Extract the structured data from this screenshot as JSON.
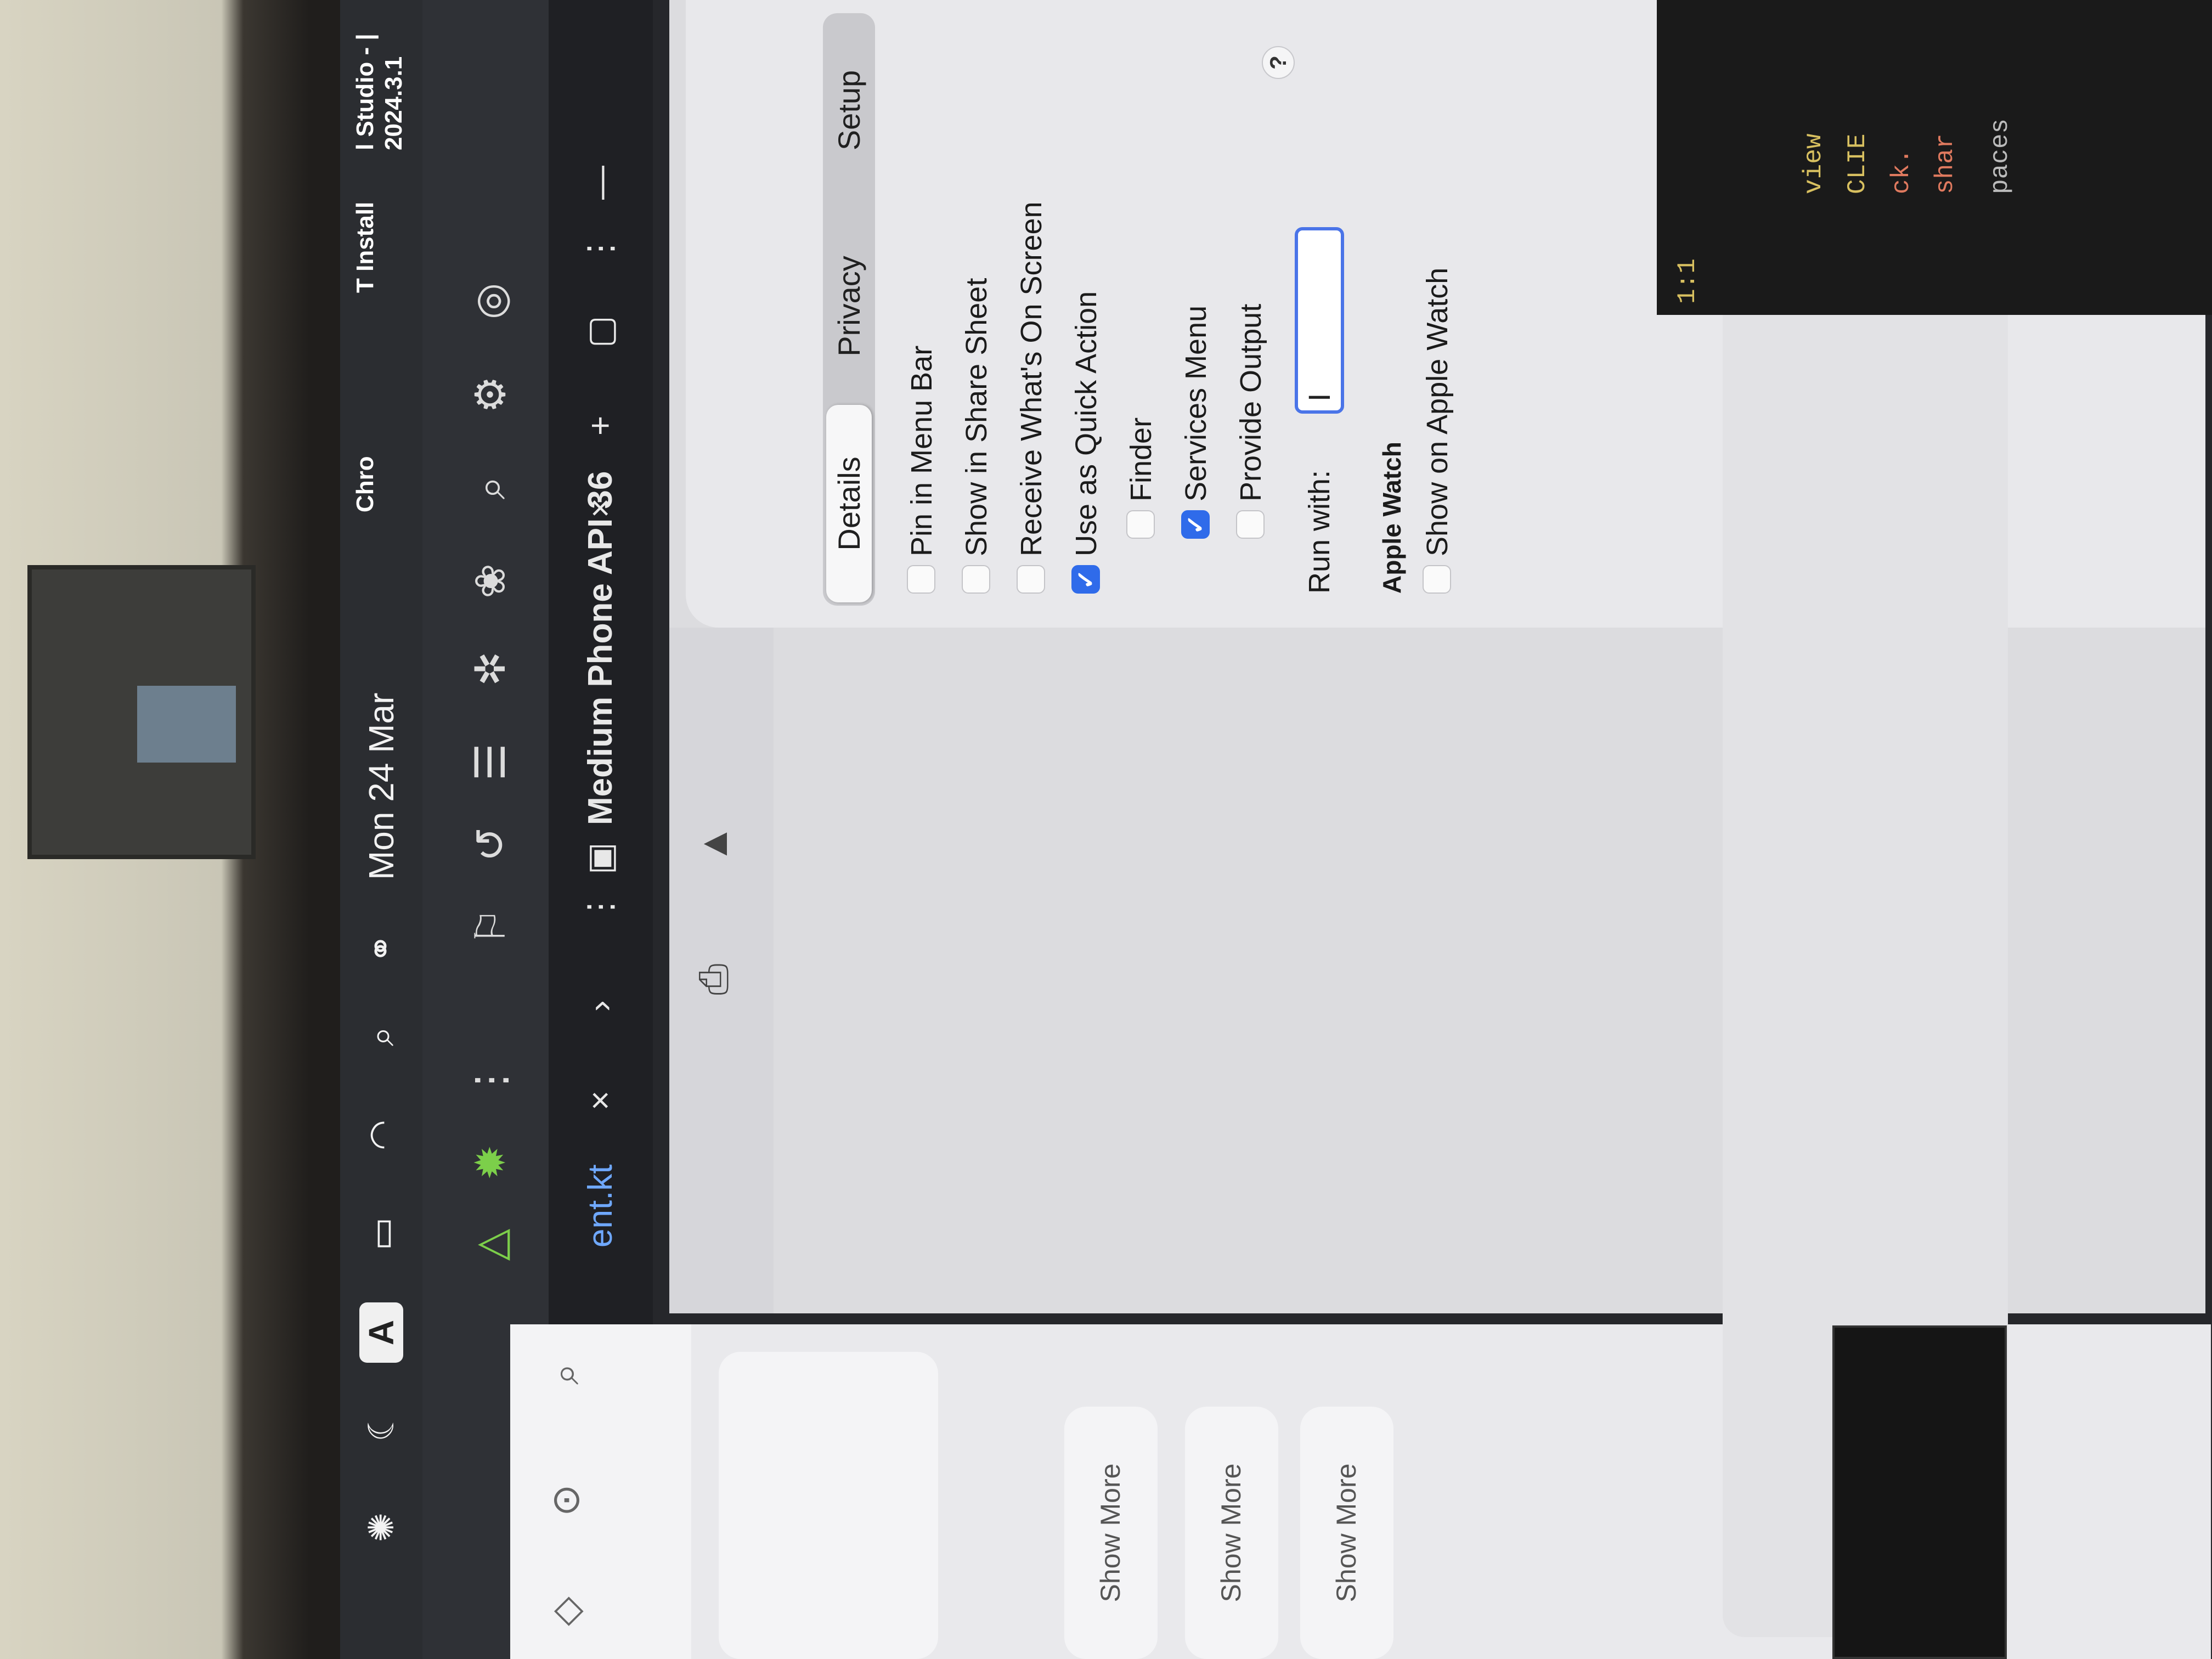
{
  "menubar": {
    "date": "Mon 24 Mar",
    "keyboard_letter": "A",
    "icons": [
      "openai-icon",
      "moon-icon",
      "battery-icon",
      "wifi-icon",
      "search-icon",
      "control-center-icon"
    ]
  },
  "dock_apps": [
    {
      "label": "Chro",
      "icon": "chrome-icon"
    },
    {
      "label": "T Install",
      "icon": "chatgpt-icon"
    },
    {
      "label": "l Studio - | 2024.3.1",
      "icon": "android-studio-icon"
    }
  ],
  "toolbar_icons": [
    "run-icon",
    "debug-icon",
    "more-icon",
    "module-icon",
    "translate-icon",
    "list-icon",
    "bug-icon",
    "plugin-icon",
    "search-icon",
    "gear-icon",
    "account-icon"
  ],
  "tabs": {
    "file_tab": "ent.kt",
    "device_tab": "Medium Phone API 36",
    "close_glyph": "×",
    "add_glyph": "+",
    "more_glyph": "⋮",
    "minimize_glyph": "—"
  },
  "settings": {
    "segments": [
      "Details",
      "Privacy",
      "Setup"
    ],
    "options": [
      {
        "label": "Pin in Menu Bar",
        "checked": false
      },
      {
        "label": "Show in Share Sheet",
        "checked": false
      },
      {
        "label": "Receive What's On Screen",
        "checked": false
      },
      {
        "label": "Use as Quick Action",
        "checked": true
      },
      {
        "label": "Finder",
        "checked": false
      },
      {
        "label": "Services Menu",
        "checked": true
      },
      {
        "label": "Provide Output",
        "checked": false
      }
    ],
    "run_with_label": "Run with:",
    "run_with_value": "I",
    "help_glyph": "?",
    "apple_watch_header": "Apple Watch",
    "apple_watch_option": {
      "label": "Show on Apple Watch",
      "checked": false
    },
    "check_glyph": "✓"
  },
  "sidepanel": {
    "show_more_labels": [
      "Show More",
      "Show More",
      "Show More"
    ]
  },
  "right_code": [
    "view",
    "CLIE",
    "ck.",
    "shar",
    "paces"
  ],
  "zoom_ratio": "1:1",
  "colors": {
    "accent": "#2f6bea",
    "screen_bg": "#26272b",
    "sheet_bg": "#e8e8eb",
    "run_green": "#7ccf4a"
  }
}
